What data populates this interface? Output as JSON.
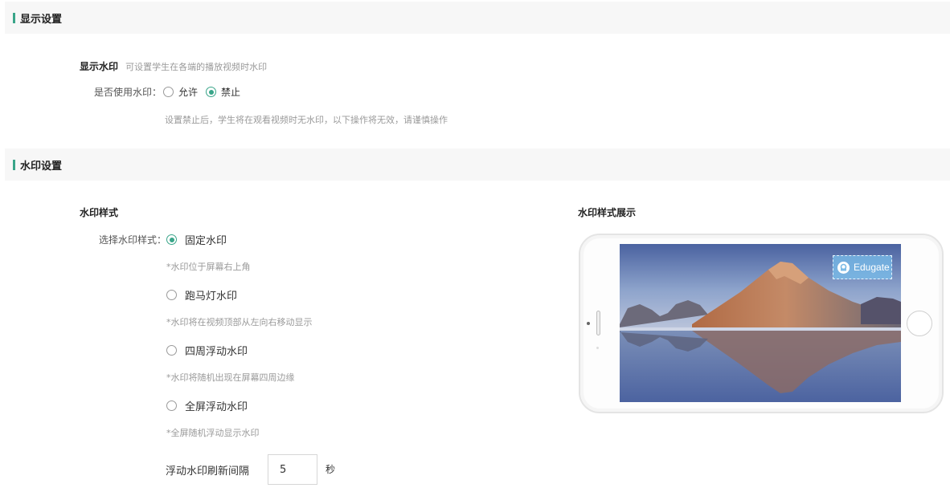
{
  "display_section": {
    "title": "显示设置",
    "watermark_label": "显示水印",
    "watermark_desc": "可设置学生在各端的播放视频时水印",
    "use_label": "是否使用水印：",
    "options": [
      {
        "label": "允许",
        "checked": false
      },
      {
        "label": "禁止",
        "checked": true
      }
    ],
    "disable_hint": "设置禁止后，学生将在观看视频时无水印，以下操作将无效，请谨慎操作"
  },
  "watermark_section": {
    "title": "水印设置",
    "style_label": "水印样式",
    "select_label": "选择水印样式：",
    "styles": [
      {
        "label": "固定水印",
        "hint": "*水印位于屏幕右上角",
        "checked": true
      },
      {
        "label": "跑马灯水印",
        "hint": "*水印将在视频顶部从左向右移动显示",
        "checked": false
      },
      {
        "label": "四周浮动水印",
        "hint": "*水印将随机出现在屏幕四周边缘",
        "checked": false
      },
      {
        "label": "全屏浮动水印",
        "hint": "*全屏随机浮动显示水印",
        "checked": false
      }
    ],
    "interval_label": "浮动水印刷新间隔",
    "interval_value": "5",
    "interval_unit": "秒",
    "preview_label": "水印样式展示",
    "preview_watermark_text": "Edugate"
  },
  "colors": {
    "accent": "#39a589",
    "header_bg": "#f7f7f7"
  }
}
